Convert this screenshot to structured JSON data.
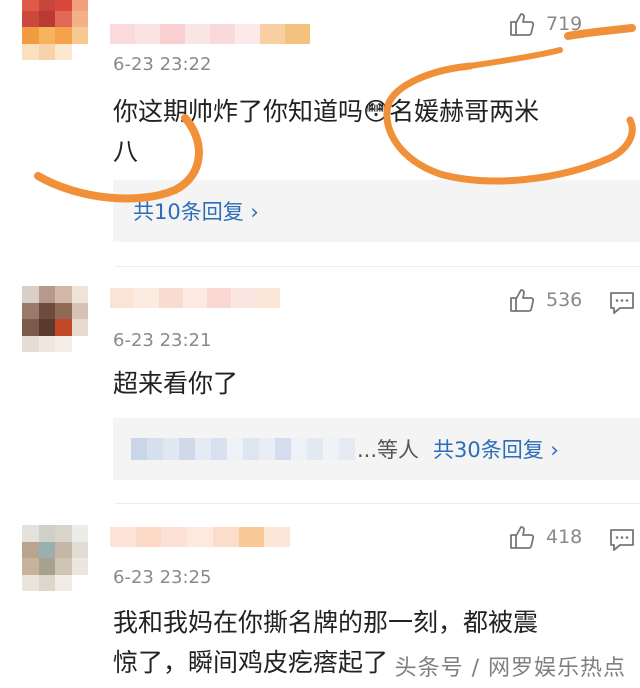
{
  "comments": [
    {
      "time": "6-23 23:22",
      "likes": "719",
      "text_line1": "你这期帅炸了你知道吗",
      "emoji": "😳",
      "text_line1b": "名媛赫哥两米",
      "text_line2": "八",
      "reply_label": "共10条回复 ›"
    },
    {
      "time": "6-23 23:21",
      "likes": "536",
      "text_line1": "超来看你了",
      "reply_prefix": "...等人",
      "reply_label": "共30条回复 ›"
    },
    {
      "time": "6-23 23:25",
      "likes": "418",
      "text_line1": "我和我妈在你撕名牌的那一刻，都被震",
      "text_line2": "惊了，瞬间鸡皮疙瘩起了"
    }
  ],
  "watermark": "头条号 / 网罗娱乐热点",
  "colors": {
    "reply_link": "#2c6db8",
    "scribble": "#f0913a"
  },
  "icons": [
    "thumbs-up-icon",
    "comment-icon",
    "chevron-right-icon"
  ]
}
